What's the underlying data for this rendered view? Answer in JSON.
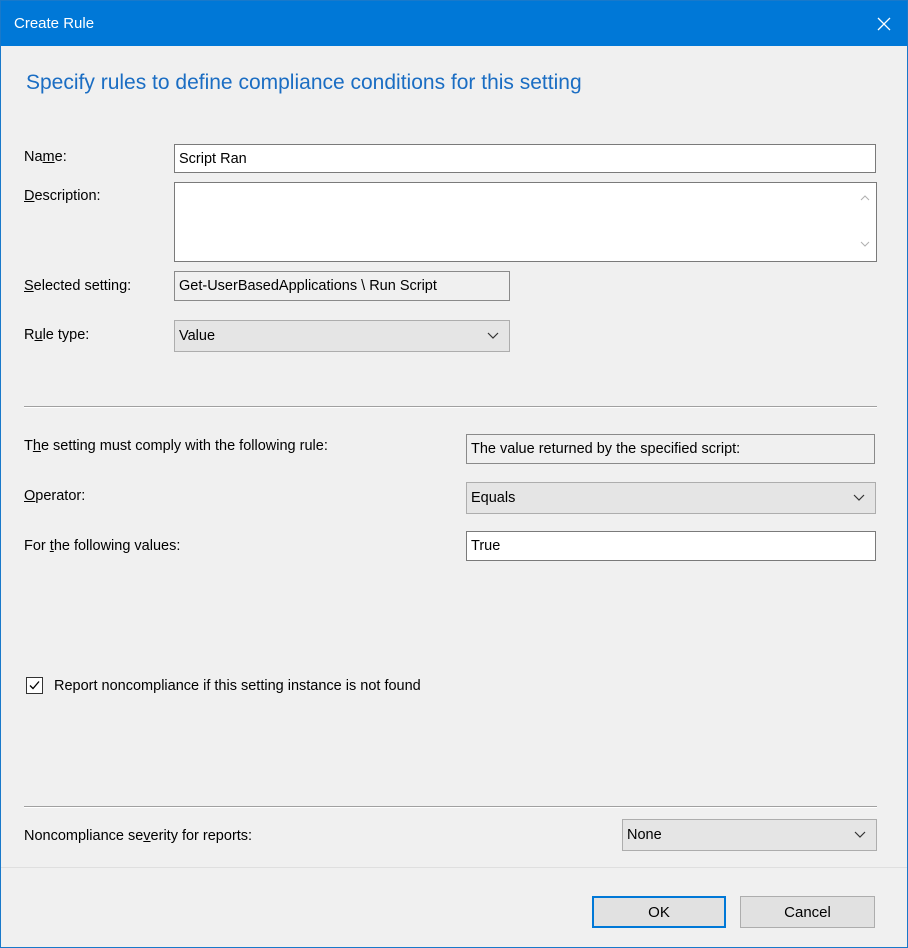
{
  "window": {
    "title": "Create Rule"
  },
  "heading": "Specify rules to define compliance conditions for this setting",
  "fields": {
    "name": {
      "label_pre": "Na",
      "label_accel": "m",
      "label_post": "e:",
      "value": "Script Ran"
    },
    "description": {
      "label_pre": "",
      "label_accel": "D",
      "label_post": "escription:",
      "value": ""
    },
    "selected_setting": {
      "label_pre": "",
      "label_accel": "S",
      "label_post": "elected setting:",
      "value": "Get-UserBasedApplications \\ Run Script"
    },
    "rule_type": {
      "label_pre": "R",
      "label_accel": "u",
      "label_post": "le type:",
      "value": "Value"
    }
  },
  "rule": {
    "comply_label_pre": "T",
    "comply_label_accel": "h",
    "comply_label_post": "e setting must comply with the following rule:",
    "comply_value": "The value returned by the specified script:",
    "operator_label_pre": "",
    "operator_label_accel": "O",
    "operator_label_post": "perator:",
    "operator_value": "Equals",
    "values_label_pre": "For ",
    "values_label_accel": "t",
    "values_label_post": "he following values:",
    "values_value": "True"
  },
  "report_checkbox": {
    "label": "Report noncompliance if this setting instance is not found",
    "checked": true
  },
  "severity": {
    "label_pre": "Noncompliance se",
    "label_accel": "v",
    "label_post": "erity for reports:",
    "value": "None"
  },
  "buttons": {
    "ok": "OK",
    "cancel": "Cancel"
  },
  "icons": {
    "close": "close-icon",
    "chevron": "chevron-down-icon",
    "check": "checkmark-icon"
  },
  "colors": {
    "title_bar": "#0078d7",
    "heading": "#1a6dc3"
  }
}
